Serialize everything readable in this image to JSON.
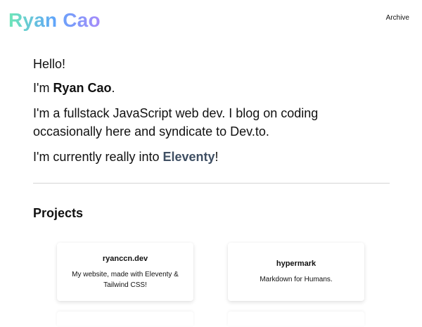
{
  "header": {
    "logo_text": "Ryan Cao",
    "nav": {
      "archive_label": "Archive"
    }
  },
  "intro": {
    "greeting": "Hello!",
    "line2_prefix": "I'm ",
    "name": "Ryan Cao",
    "line2_suffix": ".",
    "bio": "I'm a fullstack JavaScript web dev. I blog on coding occasionally here and syndicate to Dev.to.",
    "line4_prefix": "I'm currently really into ",
    "interest_link": "Eleventy",
    "line4_suffix": "!"
  },
  "projects": {
    "heading": "Projects",
    "items": [
      {
        "name": "ryanccn.dev",
        "description": "My website, made with Eleventy & Tailwind CSS!"
      },
      {
        "name": "hypermark",
        "description": "Markdown for Humans."
      }
    ]
  },
  "colors": {
    "logo_gradient": [
      "#6ee7b7",
      "#60a5fa",
      "#a78bfa"
    ],
    "link_color": "#3f4f63",
    "divider": "#d4d4d4"
  }
}
